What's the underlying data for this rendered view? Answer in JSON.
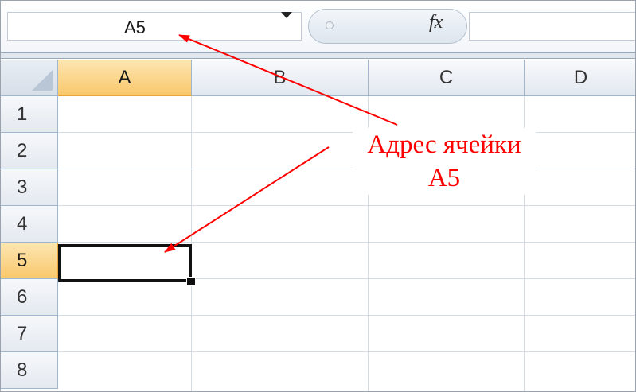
{
  "name_box": {
    "value": "A5"
  },
  "formula_bar": {
    "fx_label": "fx",
    "value": ""
  },
  "columns": [
    "A",
    "B",
    "C",
    "D"
  ],
  "rows": [
    "1",
    "2",
    "3",
    "4",
    "5",
    "6",
    "7",
    "8"
  ],
  "active_cell": {
    "column": "A",
    "row": "5"
  },
  "annotation": {
    "line1": "Адрес ячейки",
    "line2": "A5",
    "color": "#ff0000"
  },
  "colors": {
    "header_active": "#f9c86c",
    "header_border": "#9eb6ce",
    "gridline": "#d4dbe3",
    "selection_border": "#111111"
  }
}
